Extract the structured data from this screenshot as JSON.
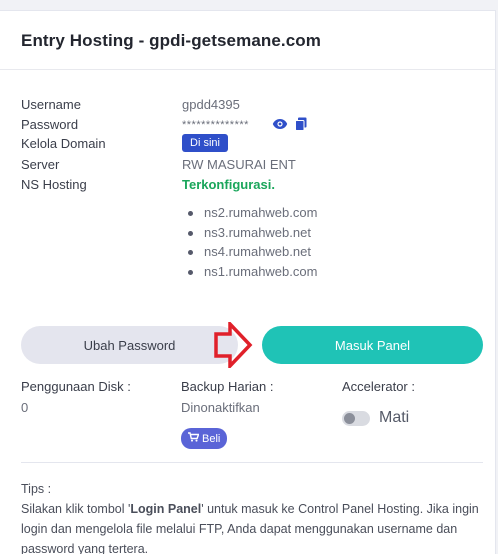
{
  "header": {
    "title": "Entry Hosting - gpdi-getsemane.com"
  },
  "info": {
    "username_label": "Username",
    "username_value": "gpdd4395",
    "password_label": "Password",
    "password_value": "**************",
    "domain_label": "Kelola Domain",
    "domain_button": "Di sini",
    "server_label": "Server",
    "server_value": "RW MASURAI ENT",
    "ns_label": "NS Hosting",
    "ns_status": "Terkonfigurasi.",
    "ns_list": [
      "ns2.rumahweb.com",
      "ns3.rumahweb.net",
      "ns4.rumahweb.net",
      "ns1.rumahweb.com"
    ]
  },
  "buttons": {
    "ubah": "Ubah Password",
    "masuk": "Masuk Panel"
  },
  "stats": {
    "disk_label": "Penggunaan Disk :",
    "disk_value": "0",
    "backup_label": "Backup Harian :",
    "backup_value": "Dinonaktifkan",
    "beli_label": "Beli",
    "accel_label": "Accelerator :",
    "accel_value": "Mati"
  },
  "tips": {
    "title": "Tips :",
    "line_pre": "Silakan klik tombol '",
    "login_panel": "Login Panel",
    "line_post": "' untuk masuk ke Control Panel Hosting. Jika ingin login dan mengelola file melalui FTP, Anda dapat menggunakan username dan password yang tertera."
  },
  "colors": {
    "accent": "#1fc3b6",
    "primary": "#2f4fc9",
    "success": "#1aa65b",
    "arrow": "#e0202a"
  }
}
